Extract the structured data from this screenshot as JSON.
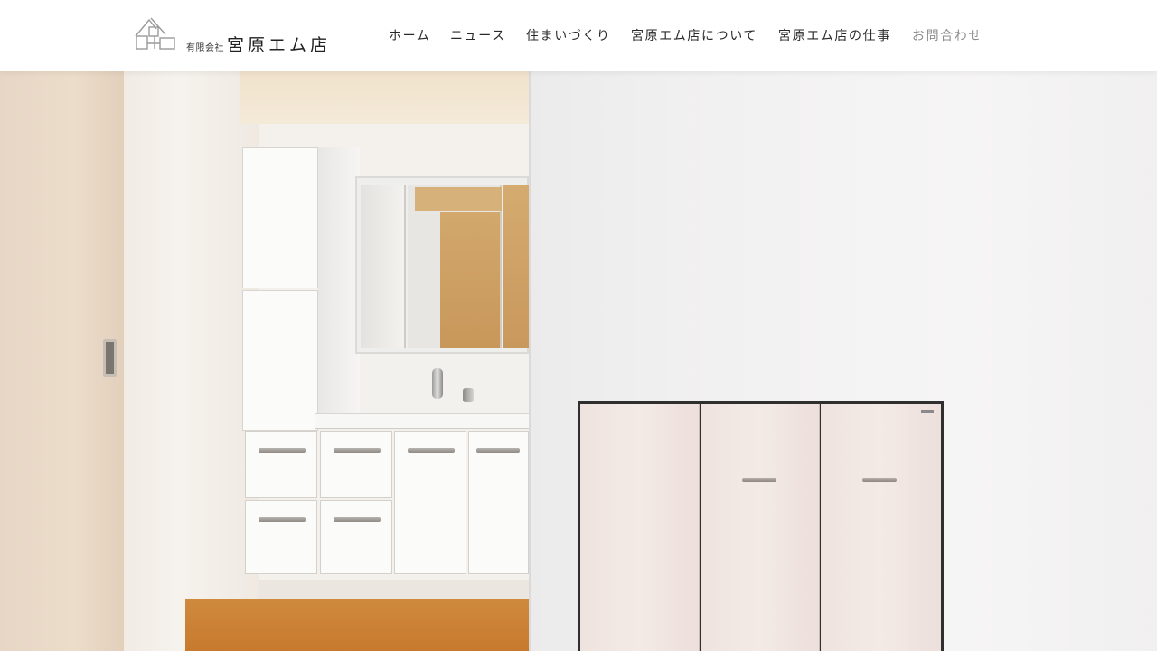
{
  "header": {
    "logo": {
      "small_text": "有限会社",
      "name": "宮原エム店"
    },
    "nav": {
      "items": [
        {
          "label": "ホーム"
        },
        {
          "label": "ニュース"
        },
        {
          "label": "住まいづくり"
        },
        {
          "label": "宮原エム店について"
        },
        {
          "label": "宮原エム店の仕事"
        },
        {
          "label": "お問合わせ"
        }
      ]
    }
  },
  "hero": {
    "image": "photo-icon"
  },
  "colors": {
    "nav_text": "#2a2a2a",
    "nav_text_muted": "#8e8e8e",
    "header_bg": "#ffffff"
  }
}
